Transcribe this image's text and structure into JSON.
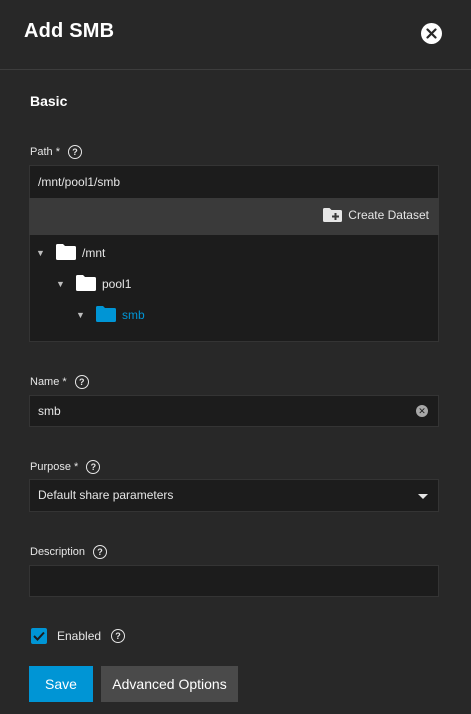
{
  "dialog": {
    "title": "Add SMB",
    "close_icon": "close-icon"
  },
  "section": {
    "title": "Basic"
  },
  "path": {
    "label": "Path",
    "required_mark": "*",
    "value": "/mnt/pool1/smb",
    "create_dataset_label": "Create Dataset",
    "tree": [
      {
        "label": "/mnt",
        "expanded": true,
        "selected": false
      },
      {
        "label": "pool1",
        "expanded": true,
        "selected": false
      },
      {
        "label": "smb",
        "expanded": true,
        "selected": true
      }
    ]
  },
  "name": {
    "label": "Name",
    "required_mark": "*",
    "value": "smb"
  },
  "purpose": {
    "label": "Purpose",
    "required_mark": "*",
    "value": "Default share parameters"
  },
  "description": {
    "label": "Description",
    "value": ""
  },
  "enabled": {
    "label": "Enabled",
    "checked": true
  },
  "actions": {
    "save_label": "Save",
    "advanced_label": "Advanced Options"
  },
  "colors": {
    "accent": "#0095d5",
    "background": "#282828",
    "field": "#1c1c1c"
  }
}
